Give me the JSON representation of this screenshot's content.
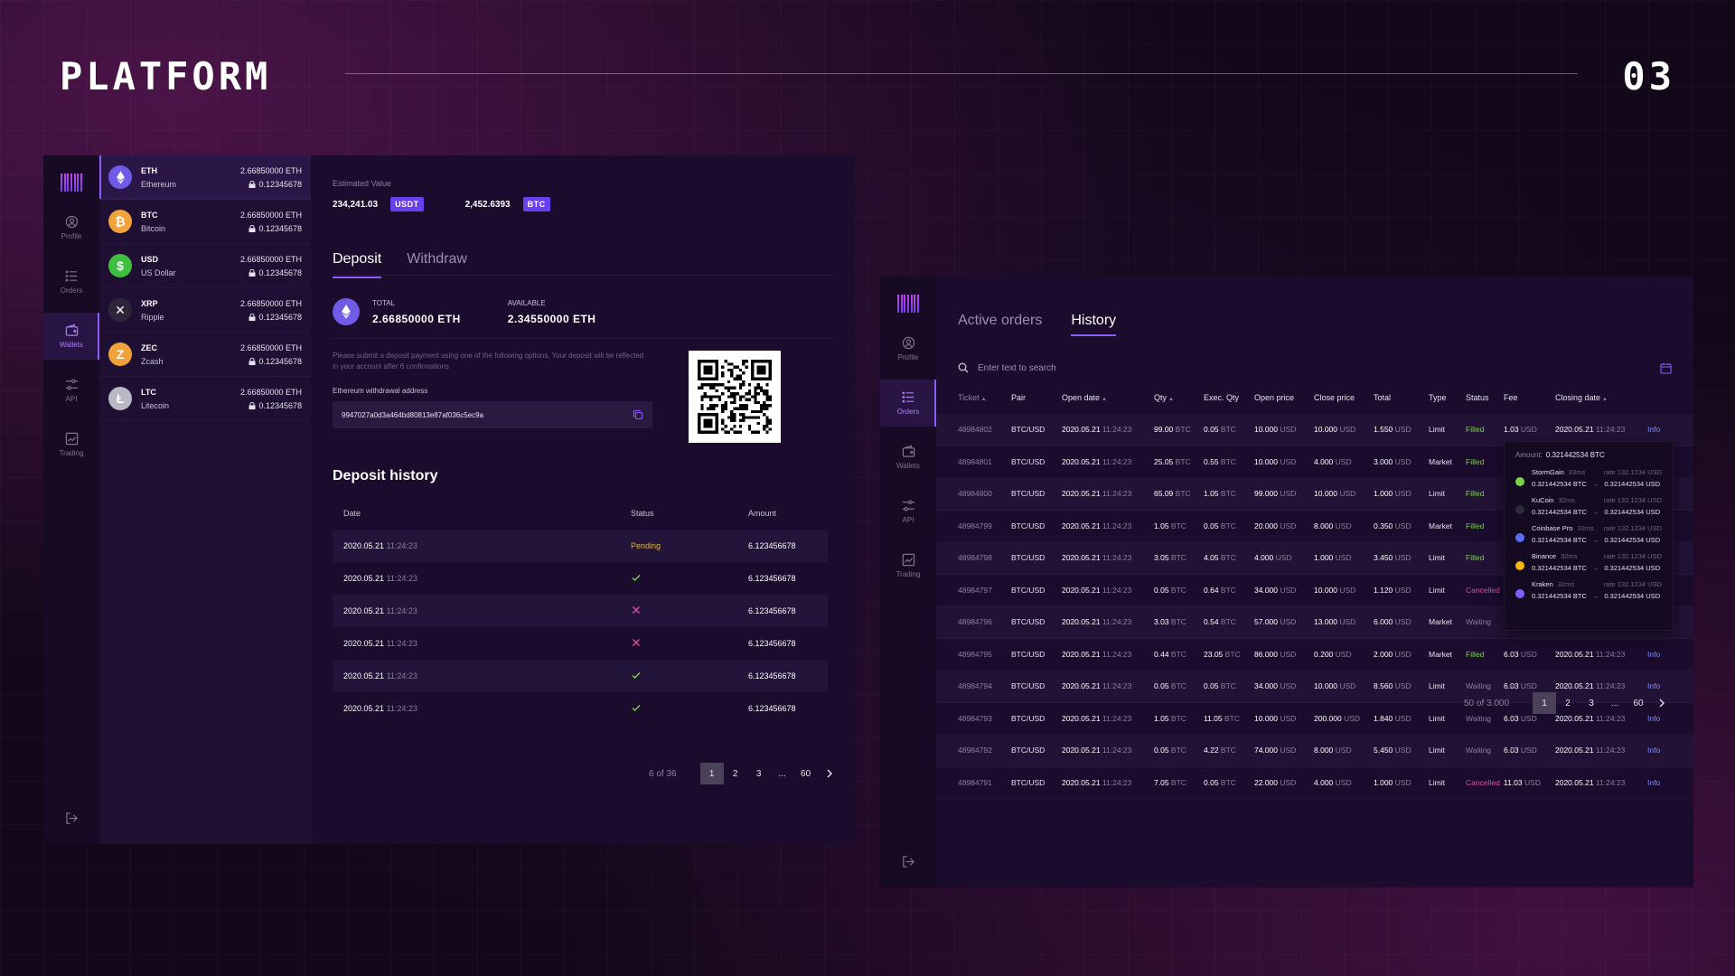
{
  "header": {
    "title": "PLATFORM",
    "page_number": "03"
  },
  "nav": {
    "items": [
      {
        "label": "Profile",
        "icon": "user-icon"
      },
      {
        "label": "Orders",
        "icon": "list-icon"
      },
      {
        "label": "Wallets",
        "icon": "wallet-icon"
      },
      {
        "label": "API",
        "icon": "sliders-icon"
      },
      {
        "label": "Trading",
        "icon": "chart-icon"
      }
    ],
    "logout_icon": "logout-icon"
  },
  "wallet": {
    "coins": [
      {
        "ticker": "ETH",
        "name": "Ethereum",
        "balance": "2.66850000 ETH",
        "locked": "0.12345678",
        "color": "#6f5be6",
        "glyph": "◆"
      },
      {
        "ticker": "BTC",
        "name": "Bitcoin",
        "balance": "2.66850000 ETH",
        "locked": "0.12345678",
        "color": "#f2a23a",
        "glyph": "₿"
      },
      {
        "ticker": "USD",
        "name": "US Dollar",
        "balance": "2.66850000 ETH",
        "locked": "0.12345678",
        "color": "#3fbf3f",
        "glyph": "$"
      },
      {
        "ticker": "XRP",
        "name": "Ripple",
        "balance": "2.66850000 ETH",
        "locked": "0.12345678",
        "color": "#2d2538",
        "glyph": "✕"
      },
      {
        "ticker": "ZEC",
        "name": "Zcash",
        "balance": "2.66850000 ETH",
        "locked": "0.12345678",
        "color": "#f2a23a",
        "glyph": "Z"
      },
      {
        "ticker": "LTC",
        "name": "Litecoin",
        "balance": "2.66850000 ETH",
        "locked": "0.12345678",
        "color": "#b9b9c6",
        "glyph": "Ł"
      }
    ],
    "estimated_label": "Estimated Value",
    "usdt_value": "234,241.03",
    "usdt_badge": "USDT",
    "btc_value": "2,452.6393",
    "btc_badge": "BTC",
    "tabs": [
      "Deposit",
      "Withdraw"
    ],
    "total_label": "TOTAL",
    "total_value": "2.66850000 ETH",
    "available_label": "AVAILABLE",
    "available_value": "2.34550000 ETH",
    "note": "Please submit a deposit payment using one of the following options. Your deposit will be reflected in your account after 6 confirmations",
    "address_label": "Ethereum withdrawal address",
    "address": "9947027a0d3a464bd80813e87af036c5ec9a",
    "history_title": "Deposit history",
    "history_headers": [
      "Date",
      "Status",
      "Amount"
    ],
    "history": [
      {
        "date": "2020.05.21",
        "time": "11:24:23",
        "status": "Pending",
        "status_type": "pending",
        "amount": "6.123456678"
      },
      {
        "date": "2020.05.21",
        "time": "11:24:23",
        "status": "",
        "status_type": "ok",
        "amount": "6.123456678"
      },
      {
        "date": "2020.05.21",
        "time": "11:24:23",
        "status": "",
        "status_type": "fail",
        "amount": "6.123456678"
      },
      {
        "date": "2020.05.21",
        "time": "11:24:23",
        "status": "",
        "status_type": "fail",
        "amount": "6.123456678"
      },
      {
        "date": "2020.05.21",
        "time": "11:24:23",
        "status": "",
        "status_type": "ok",
        "amount": "6.123456678"
      },
      {
        "date": "2020.05.21",
        "time": "11:24:23",
        "status": "",
        "status_type": "ok",
        "amount": "6.123456678"
      }
    ],
    "pager": {
      "info": "6 of 36",
      "pages": [
        "1",
        "2",
        "3",
        "...",
        "60"
      ],
      "active": "1"
    }
  },
  "orders": {
    "tabs": [
      "Active orders",
      "History"
    ],
    "search_placeholder": "Enter text to search",
    "headers": [
      "Ticket",
      "Pair",
      "Open date",
      "Qty",
      "Exec. Qty",
      "Open price",
      "Close price",
      "Total",
      "Type",
      "Status",
      "Fee",
      "Closing date",
      ""
    ],
    "rows": [
      {
        "ticket": "48984802",
        "pair": "BTC/USD",
        "open_date": "2020.05.21",
        "open_time": "11:24:23",
        "qty": "99.00",
        "exec_qty": "0.05",
        "open_price": "10.000",
        "close_price": "10.000",
        "total": "1.550",
        "type": "Limit",
        "status": "Filled",
        "fee": "1.03",
        "close_date": "2020.05.21",
        "close_time": "11:24:23",
        "info": "Info"
      },
      {
        "ticket": "48984801",
        "pair": "BTC/USD",
        "open_date": "2020.05.21",
        "open_time": "11:24:23",
        "qty": "25.05",
        "exec_qty": "0.55",
        "open_price": "10.000",
        "close_price": "4.000",
        "total": "3.000",
        "type": "Market",
        "status": "Filled",
        "fee": "",
        "close_date": "",
        "close_time": "",
        "info": ""
      },
      {
        "ticket": "48984800",
        "pair": "BTC/USD",
        "open_date": "2020.05.21",
        "open_time": "11:24:23",
        "qty": "65.09",
        "exec_qty": "1.05",
        "open_price": "99.000",
        "close_price": "10.000",
        "total": "1.000",
        "type": "Limit",
        "status": "Filled",
        "fee": "",
        "close_date": "",
        "close_time": "",
        "info": ""
      },
      {
        "ticket": "48984799",
        "pair": "BTC/USD",
        "open_date": "2020.05.21",
        "open_time": "11:24:23",
        "qty": "1.05",
        "exec_qty": "0.05",
        "open_price": "20.000",
        "close_price": "8.000",
        "total": "0.350",
        "type": "Market",
        "status": "Filled",
        "fee": "",
        "close_date": "",
        "close_time": "",
        "info": ""
      },
      {
        "ticket": "48984798",
        "pair": "BTC/USD",
        "open_date": "2020.05.21",
        "open_time": "11:24:23",
        "qty": "3.05",
        "exec_qty": "4.05",
        "open_price": "4.000",
        "close_price": "1.000",
        "total": "3.450",
        "type": "Limit",
        "status": "Filled",
        "fee": "",
        "close_date": "",
        "close_time": "",
        "info": ""
      },
      {
        "ticket": "48984797",
        "pair": "BTC/USD",
        "open_date": "2020.05.21",
        "open_time": "11:24:23",
        "qty": "0.05",
        "exec_qty": "0.64",
        "open_price": "34.000",
        "close_price": "10.000",
        "total": "1.120",
        "type": "Limit",
        "status": "Cancelled",
        "fee": "",
        "close_date": "",
        "close_time": "",
        "info": ""
      },
      {
        "ticket": "48984796",
        "pair": "BTC/USD",
        "open_date": "2020.05.21",
        "open_time": "11:24:23",
        "qty": "3.03",
        "exec_qty": "0.54",
        "open_price": "57.000",
        "close_price": "13.000",
        "total": "6.000",
        "type": "Market",
        "status": "Waiting",
        "fee": "",
        "close_date": "",
        "close_time": "",
        "info": ""
      },
      {
        "ticket": "48984795",
        "pair": "BTC/USD",
        "open_date": "2020.05.21",
        "open_time": "11:24:23",
        "qty": "0.44",
        "exec_qty": "23.05",
        "open_price": "86.000",
        "close_price": "0.200",
        "total": "2.000",
        "type": "Market",
        "status": "Filled",
        "fee": "6.03",
        "close_date": "2020.05.21",
        "close_time": "11:24:23",
        "info": "Info"
      },
      {
        "ticket": "48984794",
        "pair": "BTC/USD",
        "open_date": "2020.05.21",
        "open_time": "11:24:23",
        "qty": "0.05",
        "exec_qty": "0.05",
        "open_price": "34.000",
        "close_price": "10.000",
        "total": "8.560",
        "type": "Limit",
        "status": "Waiting",
        "fee": "6.03",
        "close_date": "2020.05.21",
        "close_time": "11:24:23",
        "info": "Info"
      },
      {
        "ticket": "48984793",
        "pair": "BTC/USD",
        "open_date": "2020.05.21",
        "open_time": "11:24:23",
        "qty": "1.05",
        "exec_qty": "11.05",
        "open_price": "10.000",
        "close_price": "200.000",
        "total": "1.840",
        "type": "Limit",
        "status": "Waiting",
        "fee": "6.03",
        "close_date": "2020.05.21",
        "close_time": "11:24:23",
        "info": "Info"
      },
      {
        "ticket": "48984792",
        "pair": "BTC/USD",
        "open_date": "2020.05.21",
        "open_time": "11:24:23",
        "qty": "0.05",
        "exec_qty": "4.22",
        "open_price": "74.000",
        "close_price": "8.000",
        "total": "5.450",
        "type": "Limit",
        "status": "Waiting",
        "fee": "6.03",
        "close_date": "2020.05.21",
        "close_time": "11:24:23",
        "info": "Info"
      },
      {
        "ticket": "48984791",
        "pair": "BTC/USD",
        "open_date": "2020.05.21",
        "open_time": "11:24:23",
        "qty": "7.05",
        "exec_qty": "0.05",
        "open_price": "22.000",
        "close_price": "4.000",
        "total": "1.000",
        "type": "Limit",
        "status": "Cancelled",
        "fee": "11.03",
        "close_date": "2020.05.21",
        "close_time": "11:24:23",
        "info": "Info"
      }
    ],
    "unit_btc": "BTC",
    "unit_usd": "USD",
    "tooltip": {
      "amount_label": "Amount:",
      "amount": "0.321442534 BTC",
      "exchanges": [
        {
          "name": "StormGain",
          "latency": "23ms",
          "rate": "rate 132.1234 USD",
          "from": "0.321442534 BTC",
          "to": "0.321442534 USD",
          "color": "#7bd44a"
        },
        {
          "name": "KuCoin",
          "latency": "32ms",
          "rate": "rate 132.1234 USD",
          "from": "0.321442534 BTC",
          "to": "0.321442534 USD",
          "color": "#2b2b3a"
        },
        {
          "name": "Coinbase Pro",
          "latency": "32ms",
          "rate": "rate 132.1234 USD",
          "from": "0.321442534 BTC",
          "to": "0.321442534 USD",
          "color": "#5b6df0"
        },
        {
          "name": "Binance",
          "latency": "32ms",
          "rate": "rate 132.1234 USD",
          "from": "0.321442534 BTC",
          "to": "0.321442534 USD",
          "color": "#f0b90b"
        },
        {
          "name": "Kraken",
          "latency": "32ms",
          "rate": "rate 132.1234 USD",
          "from": "0.321442534 BTC",
          "to": "0.321442534 USD",
          "color": "#7b61ff"
        }
      ]
    },
    "pager": {
      "info": "50 of 3.000",
      "pages": [
        "1",
        "2",
        "3",
        "...",
        "60"
      ],
      "active": "1"
    }
  }
}
